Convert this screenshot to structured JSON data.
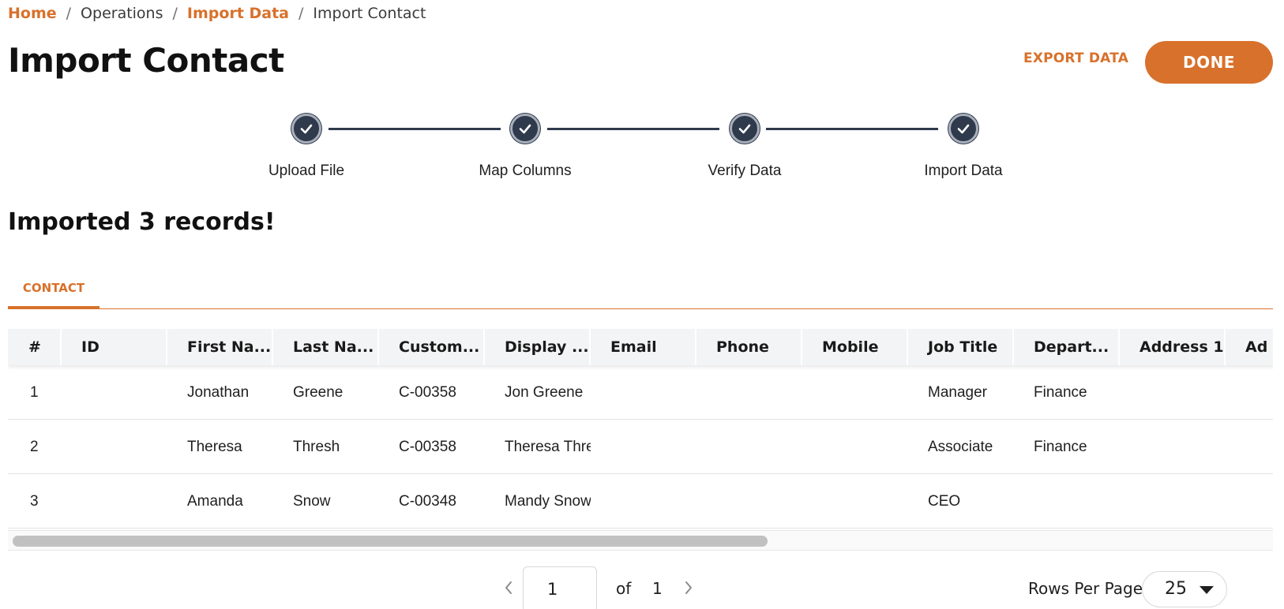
{
  "breadcrumb": {
    "items": [
      "Home",
      "Operations",
      "Import Data",
      "Import Contact"
    ],
    "separator": "/"
  },
  "page": {
    "title": "Import Contact"
  },
  "actions": {
    "export_label": "EXPORT DATA",
    "done_label": "DONE"
  },
  "stepper": {
    "steps": [
      {
        "label": "Upload File",
        "status": "complete"
      },
      {
        "label": "Map Columns",
        "status": "complete"
      },
      {
        "label": "Verify Data",
        "status": "complete"
      },
      {
        "label": "Import Data",
        "status": "complete"
      }
    ]
  },
  "result": {
    "message": "Imported 3 records!"
  },
  "tabs": [
    {
      "label": "CONTACT",
      "active": true
    }
  ],
  "table": {
    "columns": [
      "#",
      "ID",
      "First Na...",
      "Last Na...",
      "Custom...",
      "Display ...",
      "Email",
      "Phone",
      "Mobile",
      "Job Title",
      "Depart...",
      "Address 1",
      "Ad"
    ],
    "rows": [
      [
        "1",
        "",
        "Jonathan",
        "Greene",
        "C-00358",
        "Jon Greene",
        "",
        "",
        "",
        "Manager",
        "Finance",
        "",
        ""
      ],
      [
        "2",
        "",
        "Theresa",
        "Thresh",
        "C-00358",
        "Theresa Thre",
        "",
        "",
        "",
        "Associate",
        "Finance",
        "",
        ""
      ],
      [
        "3",
        "",
        "Amanda",
        "Snow",
        "C-00348",
        "Mandy Snow",
        "",
        "",
        "",
        "CEO",
        "",
        "",
        ""
      ]
    ]
  },
  "pagination": {
    "current_page": "1",
    "of_label": "of",
    "total_pages": "1",
    "rows_per_page_label": "Rows Per Page",
    "rows_per_page": "25"
  },
  "colors": {
    "accent": "#d8712b",
    "step": "#2f3a4d",
    "header_bg": "#f3f4f6"
  },
  "icons": {
    "step": "check-icon",
    "prev": "chevron-left-icon",
    "next": "chevron-right-icon",
    "dropdown": "caret-down-icon"
  }
}
